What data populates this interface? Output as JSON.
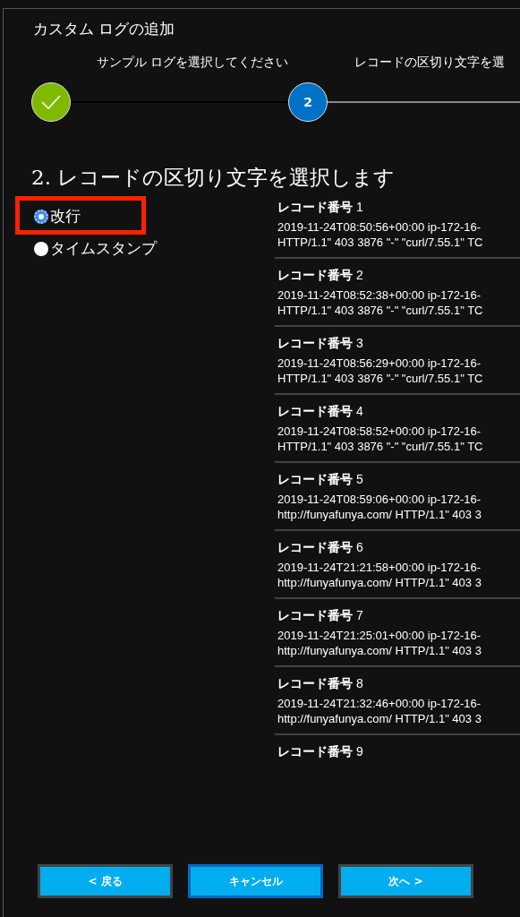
{
  "window": {
    "title": "カスタム ログの追加"
  },
  "steps": [
    {
      "label": "サンプル ログを選択してください",
      "done": true
    },
    {
      "label": "レコードの区切り文字を選",
      "done": false,
      "number": "2"
    }
  ],
  "heading": "2. レコードの区切り文字を選択します",
  "options": [
    {
      "label": "改行",
      "selected": true,
      "highlighted": true
    },
    {
      "label": "タイムスタンプ",
      "selected": false,
      "highlighted": false
    }
  ],
  "records": [
    {
      "title": "レコード番号",
      "number": "1",
      "lines": [
        "2019-11-24T08:50:56+00:00 ip-172-16-",
        "HTTP/1.1\" 403 3876 \"-\" \"curl/7.55.1\" TC"
      ]
    },
    {
      "title": "レコード番号",
      "number": "2",
      "lines": [
        "2019-11-24T08:52:38+00:00 ip-172-16-",
        "HTTP/1.1\" 403 3876 \"-\" \"curl/7.55.1\" TC"
      ]
    },
    {
      "title": "レコード番号",
      "number": "3",
      "lines": [
        "2019-11-24T08:56:29+00:00 ip-172-16-",
        "HTTP/1.1\" 403 3876 \"-\" \"curl/7.55.1\" TC"
      ]
    },
    {
      "title": "レコード番号",
      "number": "4",
      "lines": [
        "2019-11-24T08:58:52+00:00 ip-172-16-",
        "HTTP/1.1\" 403 3876 \"-\" \"curl/7.55.1\" TC"
      ]
    },
    {
      "title": "レコード番号",
      "number": "5",
      "lines": [
        "2019-11-24T08:59:06+00:00 ip-172-16-",
        "http://funyafunya.com/ HTTP/1.1\" 403 3"
      ]
    },
    {
      "title": "レコード番号",
      "number": "6",
      "lines": [
        "2019-11-24T21:21:58+00:00 ip-172-16-",
        "http://funyafunya.com/ HTTP/1.1\" 403 3"
      ]
    },
    {
      "title": "レコード番号",
      "number": "7",
      "lines": [
        "2019-11-24T21:25:01+00:00 ip-172-16-",
        "http://funyafunya.com/ HTTP/1.1\" 403 3"
      ]
    },
    {
      "title": "レコード番号",
      "number": "8",
      "lines": [
        "2019-11-24T21:32:46+00:00 ip-172-16-",
        "http://funyafunya.com/ HTTP/1.1\" 403 3"
      ]
    },
    {
      "title": "レコード番号",
      "number": "9"
    }
  ],
  "buttons": [
    {
      "label": "< 戻る",
      "focused": false
    },
    {
      "label": "キャンセル",
      "focused": true
    },
    {
      "label": "次へ >",
      "focused": false
    }
  ]
}
